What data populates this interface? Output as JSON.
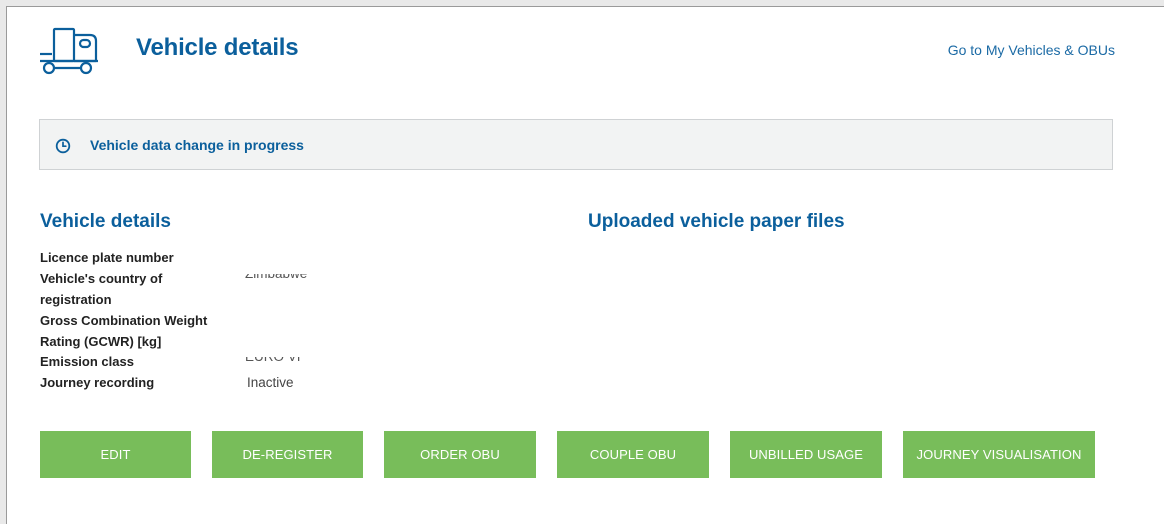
{
  "header": {
    "title": "Vehicle details",
    "link_label": "Go to My Vehicles & OBUs",
    "icon": "truck-icon"
  },
  "notice": {
    "icon": "clock-icon",
    "text": "Vehicle data change in progress"
  },
  "details": {
    "heading": "Vehicle details",
    "fields": [
      {
        "label_line1": "Licence plate number",
        "label_line2": "",
        "value": ""
      },
      {
        "label_line1": "Vehicle's country of",
        "label_line2": "registration",
        "value": "Zimbabwe"
      },
      {
        "label_line1": "Gross Combination Weight",
        "label_line2": "Rating (GCWR) [kg]",
        "value": ""
      },
      {
        "label_line1": "Emission class",
        "label_line2": "",
        "value": "EURO VI"
      },
      {
        "label_line1": "Journey recording",
        "label_line2": "",
        "value": "Inactive"
      }
    ]
  },
  "files": {
    "heading": "Uploaded vehicle paper files"
  },
  "actions": {
    "edit": "EDIT",
    "deregister": "DE-REGISTER",
    "order_obu": "ORDER OBU",
    "couple_obu": "COUPLE OBU",
    "unbilled_usage": "UNBILLED USAGE",
    "journey_visualisation": "JOURNEY VISUALISATION"
  },
  "colors": {
    "brand_blue": "#0b5f9c",
    "button_green": "#78bd5a",
    "notice_bg": "#f2f3f3"
  }
}
